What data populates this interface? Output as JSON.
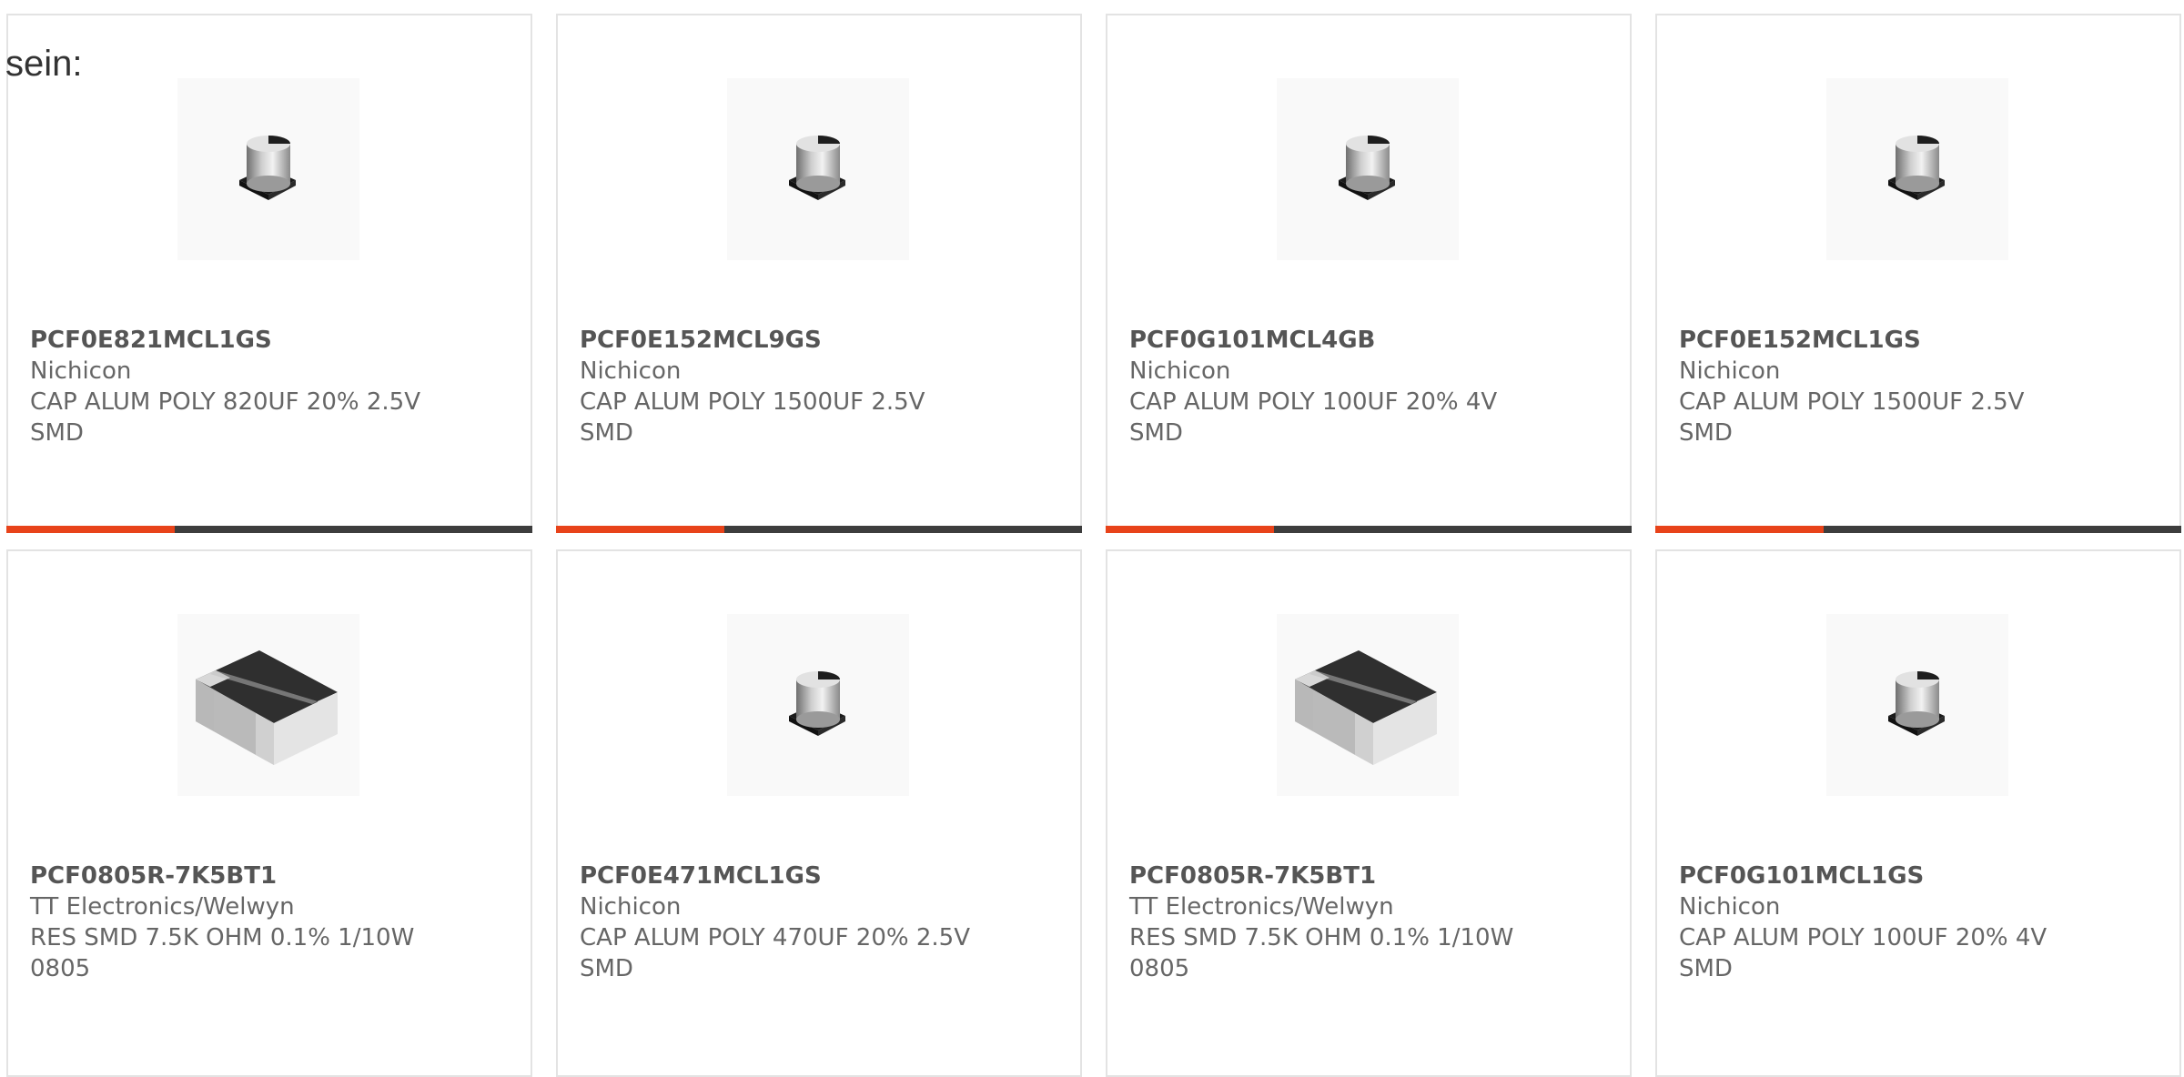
{
  "heading": "sein:",
  "colors": {
    "accent": "#e8431a",
    "bar": "#3d3d3d",
    "border": "#e3e3e3",
    "text": "#666666"
  },
  "products": [
    {
      "part_number": "PCF0E821MCL1GS",
      "manufacturer": "Nichicon",
      "description": "CAP ALUM POLY 820UF 20% 2.5V SMD",
      "image": "smd-aluminum-polymer-capacitor",
      "progress": 0.32
    },
    {
      "part_number": "PCF0E152MCL9GS",
      "manufacturer": "Nichicon",
      "description": "CAP ALUM POLY 1500UF 2.5V SMD",
      "image": "smd-aluminum-polymer-capacitor",
      "progress": 0.32
    },
    {
      "part_number": "PCF0G101MCL4GB",
      "manufacturer": "Nichicon",
      "description": "CAP ALUM POLY 100UF 20% 4V SMD",
      "image": "smd-aluminum-polymer-capacitor",
      "progress": 0.32
    },
    {
      "part_number": "PCF0E152MCL1GS",
      "manufacturer": "Nichicon",
      "description": "CAP ALUM POLY 1500UF 2.5V SMD",
      "image": "smd-aluminum-polymer-capacitor",
      "progress": 0.32
    },
    {
      "part_number": "PCF0805R-7K5BT1",
      "manufacturer": "TT Electronics/Welwyn",
      "description": "RES SMD 7.5K OHM 0.1% 1/10W 0805",
      "image": "smd-chip-resistor"
    },
    {
      "part_number": "PCF0E471MCL1GS",
      "manufacturer": "Nichicon",
      "description": "CAP ALUM POLY 470UF 20% 2.5V SMD",
      "image": "smd-aluminum-polymer-capacitor"
    },
    {
      "part_number": "PCF0805R-7K5BT1",
      "manufacturer": "TT Electronics/Welwyn",
      "description": "RES SMD 7.5K OHM 0.1% 1/10W 0805",
      "image": "smd-chip-resistor"
    },
    {
      "part_number": "PCF0G101MCL1GS",
      "manufacturer": "Nichicon",
      "description": "CAP ALUM POLY 100UF 20% 4V SMD",
      "image": "smd-aluminum-polymer-capacitor"
    }
  ]
}
